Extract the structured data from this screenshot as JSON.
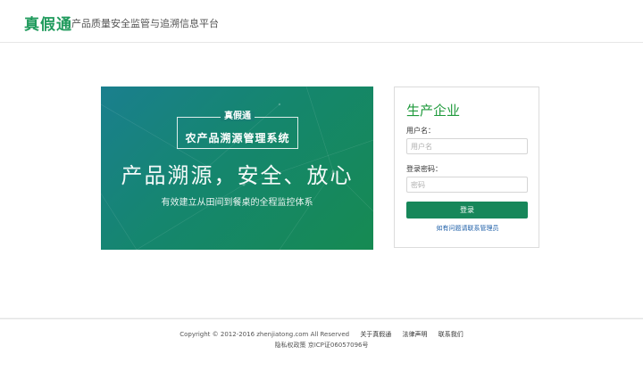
{
  "header": {
    "logo": "真假通",
    "slogan": "产品质量安全监管与追溯信息平台"
  },
  "banner": {
    "brand": "真假通",
    "system_name": "农产品溯源管理系统",
    "headline": "产品溯源，安全、放心",
    "subline": "有效建立从田间到餐桌的全程监控体系"
  },
  "login": {
    "title": "生产企业",
    "username_label": "用户名：",
    "username_placeholder": "用户名",
    "password_label": "登录密码：",
    "password_placeholder": "密码",
    "submit_label": "登录",
    "help_link": "如有问题请联系管理员"
  },
  "footer": {
    "copyright": "Copyright © 2012-2016 zhenjiatong.com All Reserved",
    "links": [
      "关于真假通",
      "法律声明",
      "联系我们"
    ],
    "privacy": "隐私权政策",
    "icp": "京ICP证06057096号"
  },
  "colors": {
    "brand_green": "#1f9a5c",
    "button_green": "#17875a",
    "link_blue": "#1e5fa8"
  }
}
